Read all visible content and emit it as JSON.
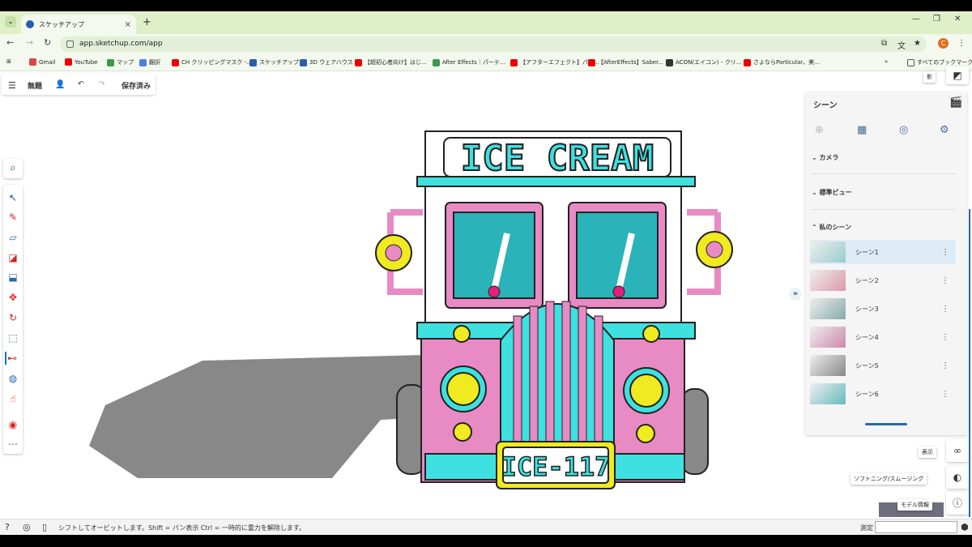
{
  "browser": {
    "tab_title": "スケッチアップ",
    "url": "app.sketchup.com/app",
    "profile_initial": "C",
    "bookmarks": [
      "Gmail",
      "YouTube",
      "マップ",
      "翻訳",
      "CH クリッピングマスク -...",
      "スケッチアップ",
      "3D ウェアハウス",
      "【超初心者向け】はじ...",
      "After Effects｜パーテ...",
      "【アフターエフェクト】パー...",
      "【AfterEffects】Saber...",
      "ACON(エイコン) - クリ...",
      "さよならParticular、美..."
    ],
    "all_bookmarks": "すべてのブックマーク"
  },
  "app": {
    "menu_icon": "hamburger-icon",
    "file_name": "無題",
    "save_status": "保存済み"
  },
  "model": {
    "sign_text": "ICE CREAM",
    "plate_text": "ICE-117"
  },
  "scene_panel": {
    "title": "シーン",
    "sections": {
      "camera": "カメラ",
      "standard_view": "標準ビュー",
      "my_scenes": "私のシーン"
    },
    "scenes": [
      "シーン1",
      "シーン2",
      "シーン3",
      "シーン4",
      "シーン5",
      "シーン6"
    ],
    "active_scene": "シーン1"
  },
  "right_rail": {
    "display": "表示",
    "softening": "ソフトニング/スムージング",
    "model_info": "モデル情報",
    "shadow": "影"
  },
  "statusbar": {
    "message": "シフトしてオービットします。Shift = パン表示 Ctrl = 一時的に重力を解除します。",
    "measure_label": "測定",
    "measure_value": ""
  },
  "colors": {
    "tab_strip": "#dff0c9",
    "accent": "#1a6fb3",
    "truck_cyan": "#3ee0e0",
    "truck_pink": "#e88ac4",
    "truck_yellow": "#f0ea20"
  }
}
